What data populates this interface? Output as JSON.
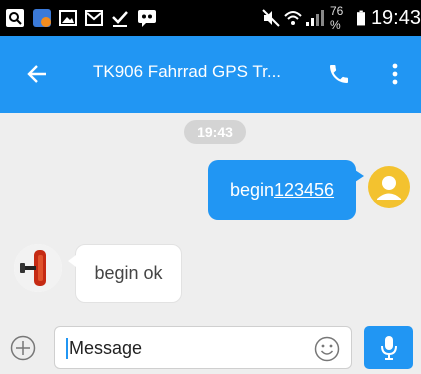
{
  "status_bar": {
    "battery_percent": "76 %",
    "time": "19:43",
    "icons": [
      "search-app-icon",
      "app-notification-icon",
      "gallery-icon",
      "email-icon",
      "download-done-icon",
      "voicemail-icon",
      "mute-icon",
      "wifi-icon",
      "signal-icon",
      "battery-icon"
    ]
  },
  "app_bar": {
    "title": "TK906 Fahrrad GPS Tr...",
    "color": "#2196f3"
  },
  "conversation": {
    "time_chip": "19:43",
    "outgoing": {
      "text_prefix": "begin",
      "text_number": "123456"
    },
    "incoming": {
      "text": "begin ok"
    }
  },
  "composer": {
    "placeholder": "Message"
  }
}
